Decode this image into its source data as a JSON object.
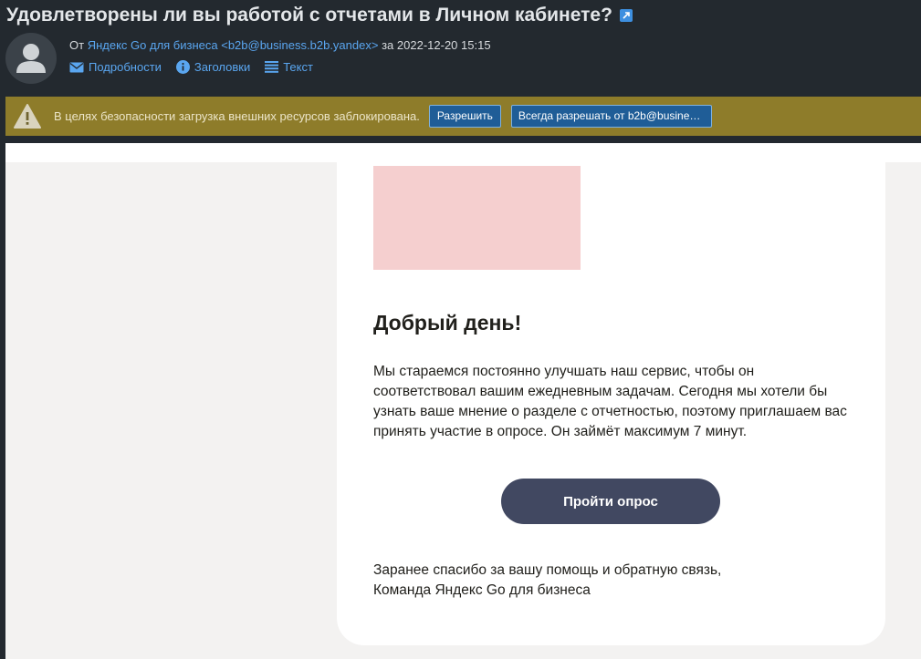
{
  "header": {
    "subject": "Удовлетворены ли вы работой с отчетами в Личном кабинете?",
    "from_prefix": "От",
    "sender": "Яндекс Go для бизнеса <b2b@business.b2b.yandex>",
    "date_prefix": "за",
    "date": "2022-12-20 15:15",
    "links": {
      "details": "Подробности",
      "headers": "Заголовки",
      "text": "Текст"
    }
  },
  "warning": {
    "message": "В целях безопасности загрузка внешних ресурсов заблокирована.",
    "allow_label": "Разрешить",
    "always_allow_label": "Всегда разрешать от b2b@busine…"
  },
  "email": {
    "greeting": "Добрый день!",
    "body": "Мы стараемся постоянно улучшать наш сервис, чтобы он соответствовал вашим ежедневным задачам. Сегодня мы хотели бы узнать ваше мнение о разделе с отчетностью, поэтому приглашаем вас принять участие в опросе. Он займёт максимум 7 минут.",
    "cta_label": "Пройти опрос",
    "closing_line1": "Заранее спасибо за вашу помощь и обратную связь,",
    "closing_line2": "Команда Яндекс Go для бизнеса"
  },
  "icons": {
    "external_link": "external-link-icon",
    "avatar": "user-avatar-icon",
    "details": "envelope-icon",
    "headers": "info-icon",
    "text": "lines-icon",
    "warning": "warning-triangle-icon"
  },
  "colors": {
    "header_bg": "#23292f",
    "link": "#5aa6f0",
    "warning_bg": "#8e7c2a",
    "button_bg": "#1f5d97",
    "cta_bg": "#414861",
    "banner_placeholder": "#f5cfcf"
  }
}
